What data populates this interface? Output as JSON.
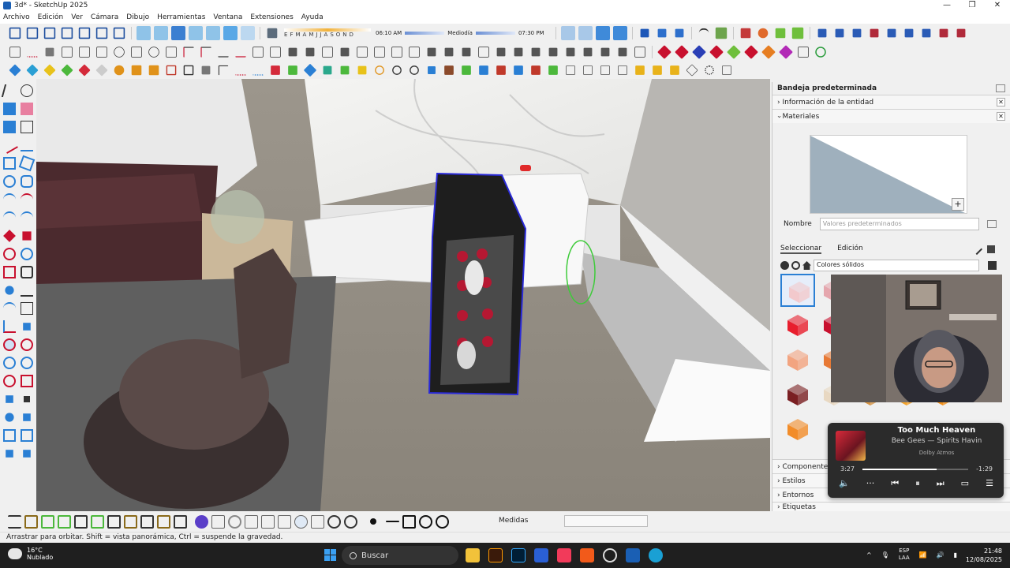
{
  "window": {
    "title": "3d* - SketchUp 2025",
    "minimize": "—",
    "restore": "❐",
    "close": "✕"
  },
  "menu": [
    "Archivo",
    "Edición",
    "Ver",
    "Cámara",
    "Dibujo",
    "Herramientas",
    "Ventana",
    "Extensiones",
    "Ayuda"
  ],
  "shadows": {
    "months": [
      "E",
      "F",
      "M",
      "A",
      "M",
      "J",
      "J",
      "A",
      "S",
      "O",
      "N",
      "D"
    ],
    "time_start": "06:10 AM",
    "time_mid": "Mediodía",
    "time_end": "07:30 PM"
  },
  "tray": {
    "title": "Bandeja predeterminada",
    "entity_info": "Información de la entidad",
    "materials": "Materiales",
    "name_label": "Nombre",
    "name_placeholder": "Valores predeterminados",
    "tab_select": "Seleccionar",
    "tab_edit": "Edición",
    "library": "Colores sólidos",
    "sections": [
      "Componentes",
      "Estilos",
      "Entornos",
      "Etiquetas"
    ],
    "close_glyph": "✕",
    "expand_glyph": "›"
  },
  "swatch_colors": [
    "#f2c9cc",
    "#e5a6ad",
    "#e81e2d",
    "#c8102e",
    "#f2a480",
    "#e77935",
    "#7a1f22",
    "#e8d8c2",
    "#d69444",
    "#f4a32b",
    "#f08f1a",
    "#f28c28"
  ],
  "media": {
    "song": "Too Much Heaven",
    "artist": "Bee Gees — Spirits Havin",
    "badge": "Dolby Atmos",
    "elapsed": "3:27",
    "remaining": "-1:29",
    "progress": 0.7
  },
  "status": {
    "measures_label": "Medidas",
    "hint": "Arrastrar para orbitar. Shift = vista panorámica, Ctrl = suspende la gravedad."
  },
  "taskbar": {
    "temp": "16°C",
    "weather": "Nublado",
    "search": "Buscar",
    "lang1": "ESP",
    "lang2": "LAA",
    "time": "21:48",
    "date": "12/08/2025"
  }
}
